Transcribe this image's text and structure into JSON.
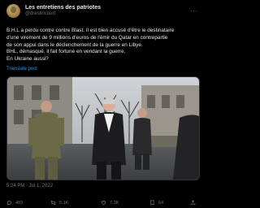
{
  "author": {
    "display_name": "Les entretiens des patriotes",
    "handle": "@dreslincourt"
  },
  "more_icon": "more-horizontal-icon",
  "tweet": {
    "lines": [
      "B.H.L a perdu contre contre Blast. Il est bien accusé d'être le destinataire",
      "d'une virement de 9 millions d'euros de l'émir du Qatar en contrepartie",
      "de son appui dans le déclenchement de la guerre en Libye.",
      "BHL, démasqué, il fait fortune en vendant la guerre.",
      "En Ukraine aussi?"
    ],
    "translate_label": "Translate post",
    "timestamp": "5:24 PM · Jul 1, 2022"
  },
  "actions": {
    "replies": "483",
    "reposts": "5.1K",
    "likes": "7.3K",
    "bookmarks": "64"
  },
  "colors": {
    "background": "#000000",
    "text": "#e7e9ea",
    "muted": "#71767b",
    "link": "#1d9bf0"
  }
}
